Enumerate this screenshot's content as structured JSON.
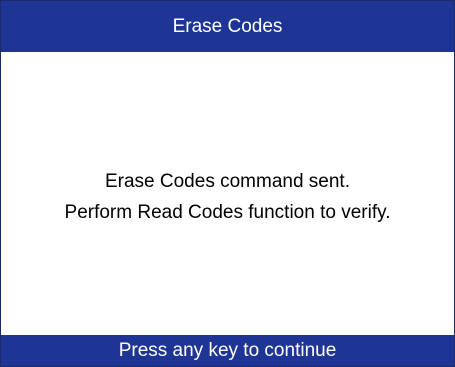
{
  "title": "Erase Codes",
  "message": {
    "line1": "Erase Codes command sent.",
    "line2": "Perform Read Codes function to verify."
  },
  "footer": {
    "prompt": "Press any key to continue"
  },
  "colors": {
    "bar_background": "#1f3596",
    "bar_text": "#ffffff",
    "body_background": "#ffffff",
    "body_text": "#000000"
  }
}
